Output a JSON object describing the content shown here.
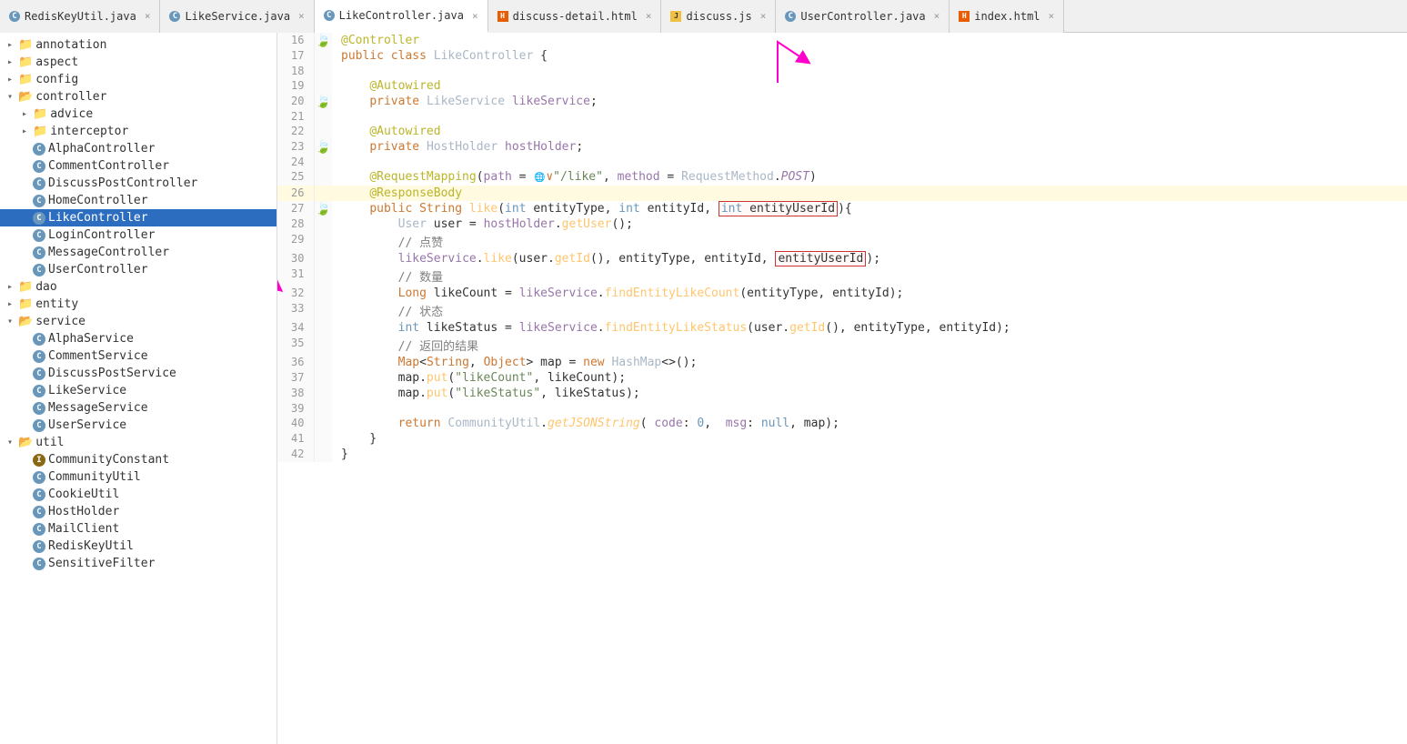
{
  "tabs": [
    {
      "id": "redis",
      "label": "RedisKeyUtil.java",
      "icon": "c",
      "active": false
    },
    {
      "id": "likeservice",
      "label": "LikeService.java",
      "icon": "c",
      "active": false
    },
    {
      "id": "likecontroller",
      "label": "LikeController.java",
      "icon": "c",
      "active": true
    },
    {
      "id": "discuss-detail",
      "label": "discuss-detail.html",
      "icon": "html",
      "active": false
    },
    {
      "id": "discuss",
      "label": "discuss.js",
      "icon": "js",
      "active": false
    },
    {
      "id": "usercontroller",
      "label": "UserController.java",
      "icon": "c",
      "active": false
    },
    {
      "id": "index",
      "label": "index.html",
      "icon": "html",
      "active": false
    }
  ],
  "sidebar": {
    "items": [
      {
        "id": "annotation",
        "label": "annotation",
        "type": "folder",
        "indent": 0,
        "state": "closed"
      },
      {
        "id": "aspect",
        "label": "aspect",
        "type": "folder",
        "indent": 0,
        "state": "closed"
      },
      {
        "id": "config",
        "label": "config",
        "type": "folder",
        "indent": 0,
        "state": "closed"
      },
      {
        "id": "controller",
        "label": "controller",
        "type": "folder",
        "indent": 0,
        "state": "open"
      },
      {
        "id": "advice",
        "label": "advice",
        "type": "folder",
        "indent": 1,
        "state": "closed"
      },
      {
        "id": "interceptor",
        "label": "interceptor",
        "type": "folder",
        "indent": 1,
        "state": "closed"
      },
      {
        "id": "AlphaController",
        "label": "AlphaController",
        "type": "file-c",
        "indent": 1
      },
      {
        "id": "CommentController",
        "label": "CommentController",
        "type": "file-c",
        "indent": 1
      },
      {
        "id": "DiscussPostController",
        "label": "DiscussPostController",
        "type": "file-c",
        "indent": 1
      },
      {
        "id": "HomeController",
        "label": "HomeController",
        "type": "file-c",
        "indent": 1
      },
      {
        "id": "LikeController",
        "label": "LikeController",
        "type": "file-c",
        "indent": 1,
        "selected": true
      },
      {
        "id": "LoginController",
        "label": "LoginController",
        "type": "file-c",
        "indent": 1
      },
      {
        "id": "MessageController",
        "label": "MessageController",
        "type": "file-c",
        "indent": 1
      },
      {
        "id": "UserController",
        "label": "UserController",
        "type": "file-c",
        "indent": 1
      },
      {
        "id": "dao",
        "label": "dao",
        "type": "folder",
        "indent": 0,
        "state": "closed"
      },
      {
        "id": "entity",
        "label": "entity",
        "type": "folder",
        "indent": 0,
        "state": "closed"
      },
      {
        "id": "service",
        "label": "service",
        "type": "folder",
        "indent": 0,
        "state": "open"
      },
      {
        "id": "AlphaService",
        "label": "AlphaService",
        "type": "file-c",
        "indent": 1
      },
      {
        "id": "CommentService",
        "label": "CommentService",
        "type": "file-c",
        "indent": 1
      },
      {
        "id": "DiscussPostService",
        "label": "DiscussPostService",
        "type": "file-c",
        "indent": 1
      },
      {
        "id": "LikeService",
        "label": "LikeService",
        "type": "file-c",
        "indent": 1
      },
      {
        "id": "MessageService",
        "label": "MessageService",
        "type": "file-c",
        "indent": 1
      },
      {
        "id": "UserService",
        "label": "UserService",
        "type": "file-c",
        "indent": 1
      },
      {
        "id": "util",
        "label": "util",
        "type": "folder",
        "indent": 0,
        "state": "open"
      },
      {
        "id": "CommunityConstant",
        "label": "CommunityConstant",
        "type": "file-i",
        "indent": 1
      },
      {
        "id": "CommunityUtil",
        "label": "CommunityUtil",
        "type": "file-c",
        "indent": 1
      },
      {
        "id": "CookieUtil",
        "label": "CookieUtil",
        "type": "file-c",
        "indent": 1
      },
      {
        "id": "HostHolder",
        "label": "HostHolder",
        "type": "file-c",
        "indent": 1
      },
      {
        "id": "MailClient",
        "label": "MailClient",
        "type": "file-c",
        "indent": 1
      },
      {
        "id": "RedisKeyUtil",
        "label": "RedisKeyUtil",
        "type": "file-c",
        "indent": 1
      },
      {
        "id": "SensitiveFilter",
        "label": "SensitiveFilter",
        "type": "file-c",
        "indent": 1
      }
    ]
  },
  "code": {
    "lines": [
      {
        "num": 16,
        "gutter": "",
        "content": "@Controller",
        "highlight": false
      },
      {
        "num": 17,
        "gutter": "",
        "content": "public class LikeController {",
        "highlight": false
      },
      {
        "num": 18,
        "gutter": "",
        "content": "",
        "highlight": false
      },
      {
        "num": 19,
        "gutter": "",
        "content": "    @Autowired",
        "highlight": false
      },
      {
        "num": 20,
        "gutter": "●",
        "content": "    private LikeService likeService;",
        "highlight": false
      },
      {
        "num": 21,
        "gutter": "",
        "content": "",
        "highlight": false
      },
      {
        "num": 22,
        "gutter": "",
        "content": "    @Autowired",
        "highlight": false
      },
      {
        "num": 23,
        "gutter": "●",
        "content": "    private HostHolder hostHolder;",
        "highlight": false
      },
      {
        "num": 24,
        "gutter": "",
        "content": "",
        "highlight": false
      },
      {
        "num": 25,
        "gutter": "",
        "content": "    @RequestMapping(path = \"/like\", method = RequestMethod.POST)",
        "highlight": false
      },
      {
        "num": 26,
        "gutter": "",
        "content": "    @ResponseBody",
        "highlight": true
      },
      {
        "num": 27,
        "gutter": "●",
        "content": "    public String like(int entityType, int entityId, [BOX1]int entityUserId[/BOX1]){",
        "highlight": false
      },
      {
        "num": 28,
        "gutter": "",
        "content": "        User user = hostHolder.getUser();",
        "highlight": false
      },
      {
        "num": 29,
        "gutter": "",
        "content": "        // 点赞",
        "highlight": false
      },
      {
        "num": 30,
        "gutter": "",
        "content": "        likeService.like(user.getId(), entityType, entityId, [BOX2]entityUserId[/BOX2]);",
        "highlight": false
      },
      {
        "num": 31,
        "gutter": "",
        "content": "        // 数量",
        "highlight": false
      },
      {
        "num": 32,
        "gutter": "",
        "content": "        Long likeCount = likeService.findEntityLikeCount(entityType, entityId);",
        "highlight": false
      },
      {
        "num": 33,
        "gutter": "",
        "content": "        // 状态",
        "highlight": false
      },
      {
        "num": 34,
        "gutter": "",
        "content": "        int likeStatus = likeService.findEntityLikeStatus(user.getId(), entityType, entityId);",
        "highlight": false
      },
      {
        "num": 35,
        "gutter": "",
        "content": "        // 返回的结果",
        "highlight": false
      },
      {
        "num": 36,
        "gutter": "",
        "content": "        Map<String, Object> map = new HashMap<>();",
        "highlight": false
      },
      {
        "num": 37,
        "gutter": "",
        "content": "        map.put(\"likeCount\", likeCount);",
        "highlight": false
      },
      {
        "num": 38,
        "gutter": "",
        "content": "        map.put(\"likeStatus\", likeStatus);",
        "highlight": false
      },
      {
        "num": 39,
        "gutter": "",
        "content": "",
        "highlight": false
      },
      {
        "num": 40,
        "gutter": "",
        "content": "        return CommunityUtil.getJSONString( code: 0,  msg: null, map);",
        "highlight": false
      },
      {
        "num": 41,
        "gutter": "",
        "content": "    }",
        "highlight": false
      },
      {
        "num": 42,
        "gutter": "",
        "content": "}",
        "highlight": false
      }
    ]
  }
}
